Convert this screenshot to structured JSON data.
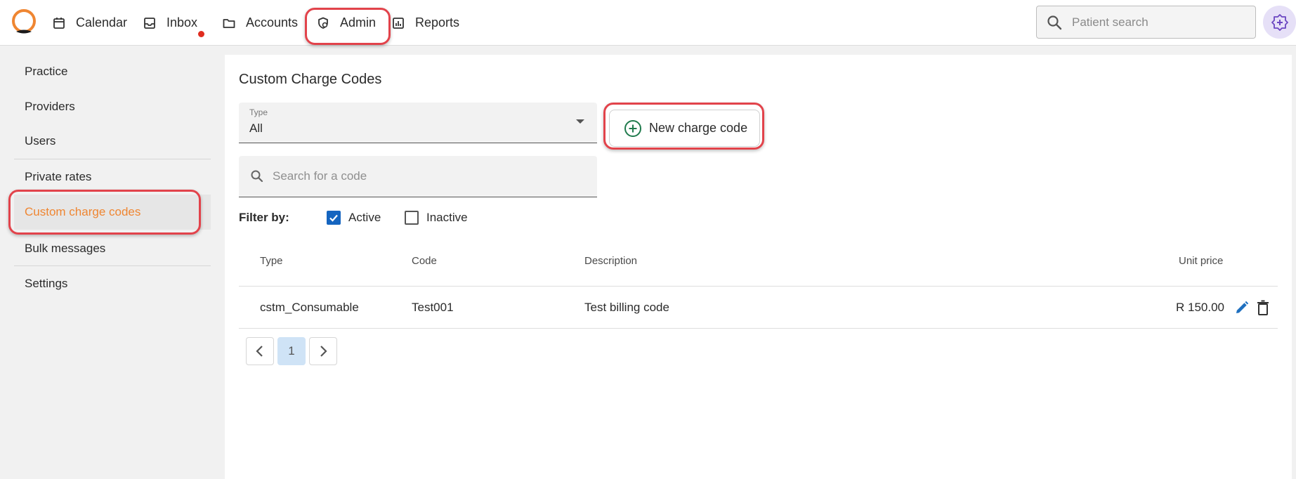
{
  "nav": {
    "calendar": "Calendar",
    "inbox": "Inbox",
    "accounts": "Accounts",
    "admin": "Admin",
    "reports": "Reports"
  },
  "search": {
    "placeholder": "Patient search"
  },
  "sidebar": {
    "items": [
      {
        "label": "Practice"
      },
      {
        "label": "Providers"
      },
      {
        "label": "Users"
      },
      {
        "label": "Private rates"
      },
      {
        "label": "Custom charge codes",
        "active": true
      },
      {
        "label": "Bulk messages"
      },
      {
        "label": "Settings"
      }
    ]
  },
  "main": {
    "title": "Custom Charge Codes",
    "type_select": {
      "label": "Type",
      "value": "All"
    },
    "code_search": {
      "placeholder": "Search for a code"
    },
    "new_button": "New charge code",
    "filter": {
      "label": "Filter by:",
      "active": {
        "label": "Active",
        "checked": true
      },
      "inactive": {
        "label": "Inactive",
        "checked": false
      }
    },
    "table": {
      "headers": [
        "Type",
        "Code",
        "Description",
        "Unit price"
      ],
      "rows": [
        {
          "type": "cstm_Consumable",
          "code": "Test001",
          "description": "Test billing code",
          "unit_price": "R 150.00"
        }
      ]
    },
    "pagination": {
      "current": "1"
    }
  },
  "colors": {
    "accent_orange": "#ef8632",
    "highlight_red": "#e2434b",
    "checkbox_blue": "#1565c0",
    "action_icon_blue": "#1e6fbf",
    "add_icon_green": "#1f7a4c"
  }
}
